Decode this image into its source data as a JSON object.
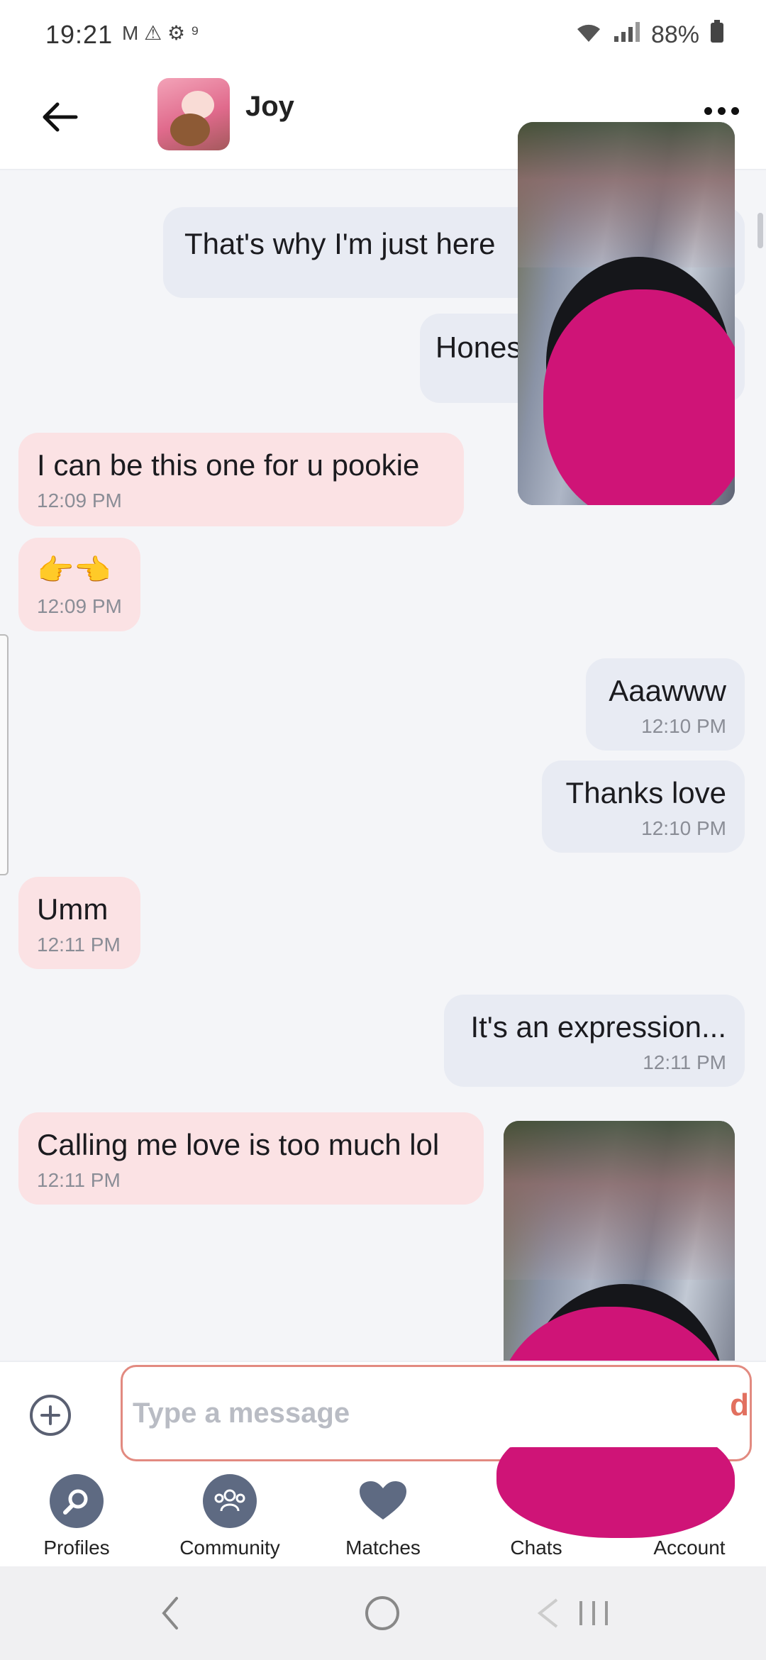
{
  "status_bar": {
    "time": "19:21",
    "left_icons_text": "M ⚠ ⚙ ⁹",
    "battery": "88%"
  },
  "header": {
    "contact_name": "Joy"
  },
  "messages": [
    {
      "direction": "sent",
      "text": "That's why I'm just here",
      "time": ""
    },
    {
      "direction": "sent",
      "text": "Hones",
      "time": ""
    },
    {
      "direction": "received",
      "text": "I can be this one for u pookie",
      "time": "12:09 PM"
    },
    {
      "direction": "received",
      "text": "👉👈",
      "time": "12:09 PM"
    },
    {
      "direction": "sent",
      "text": "Aaawww",
      "time": "12:10 PM"
    },
    {
      "direction": "sent",
      "text": "Thanks love",
      "time": "12:10 PM"
    },
    {
      "direction": "received",
      "text": "Umm",
      "time": "12:11 PM"
    },
    {
      "direction": "sent",
      "text": "It's an expression...",
      "time": "12:11 PM"
    },
    {
      "direction": "received",
      "text": "Calling me love is too much lol",
      "time": "12:11 PM"
    }
  ],
  "input": {
    "placeholder": "Type a message",
    "send_peek": "d"
  },
  "bottom_nav": [
    {
      "label": "Profiles",
      "icon": "search-icon"
    },
    {
      "label": "Community",
      "icon": "people-icon"
    },
    {
      "label": "Matches",
      "icon": "heart-icon"
    },
    {
      "label": "Chats",
      "icon": "chat-icon"
    },
    {
      "label": "Account",
      "icon": "account-icon"
    }
  ],
  "colors": {
    "accent": "#e2705f",
    "sent_bubble": "#e8ebf3",
    "received_bubble": "#fbe2e4",
    "redaction": "#cf1477",
    "nav_icon": "#5e6a82"
  }
}
